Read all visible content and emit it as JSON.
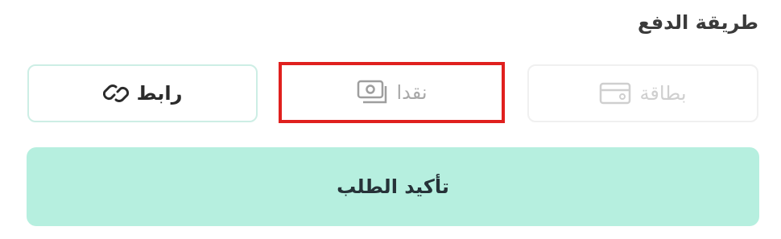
{
  "payment": {
    "title": "طريقة الدفع",
    "methods": {
      "card": {
        "label": "بطاقة",
        "icon": "card-icon"
      },
      "cash": {
        "label": "نقدا",
        "icon": "cash-icon"
      },
      "link": {
        "label": "رابط",
        "icon": "link-icon"
      }
    },
    "confirm_label": "تأكيد الطلب"
  },
  "colors": {
    "confirm_bg": "#b6efdf",
    "highlight_border": "#e0201e",
    "link_border": "#cdeee5"
  }
}
